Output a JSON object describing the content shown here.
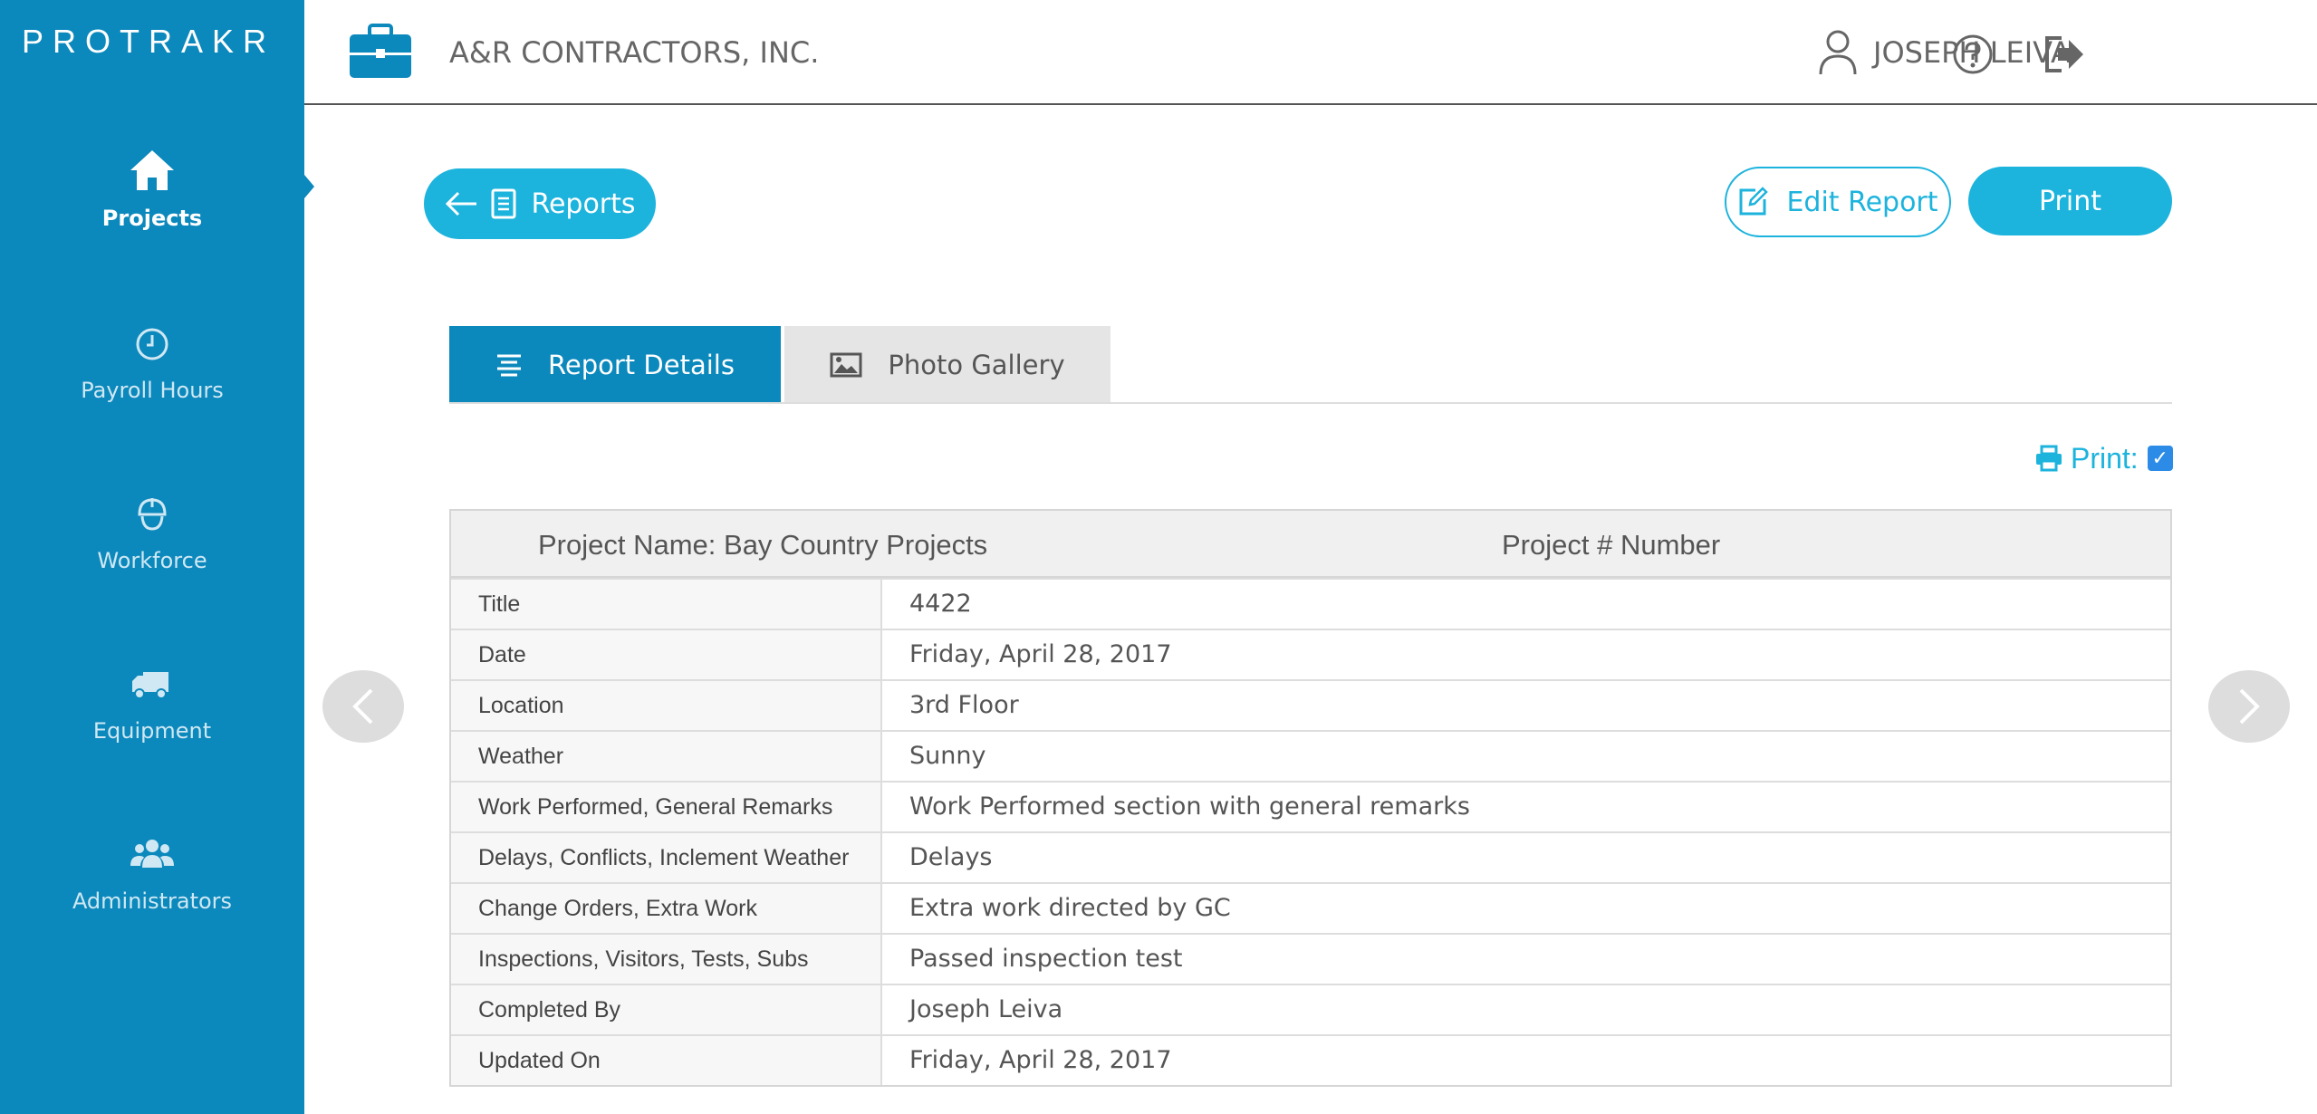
{
  "app": {
    "logo_text": "PROTRAKR",
    "company_name": "A&R CONTRACTORS, INC.",
    "user_name": "JOSEPH LEIVA"
  },
  "sidebar": {
    "items": [
      {
        "label": "Projects",
        "icon": "home-icon",
        "active": true
      },
      {
        "label": "Payroll Hours",
        "icon": "clock-icon",
        "active": false
      },
      {
        "label": "Workforce",
        "icon": "worker-icon",
        "active": false
      },
      {
        "label": "Equipment",
        "icon": "truck-icon",
        "active": false
      },
      {
        "label": "Administrators",
        "icon": "users-icon",
        "active": false
      }
    ]
  },
  "toolbar": {
    "back_label": "Reports",
    "edit_label": "Edit Report",
    "print_label": "Print"
  },
  "tabs": [
    {
      "label": "Report Details",
      "icon": "list-icon",
      "active": true
    },
    {
      "label": "Photo Gallery",
      "icon": "image-icon",
      "active": false
    }
  ],
  "print_toggle": {
    "label": "Print:",
    "checked": true
  },
  "report": {
    "project_name": "Project Name: Bay Country Projects",
    "project_number": "Project # Number",
    "rows": [
      {
        "label": "Title",
        "value": "4422"
      },
      {
        "label": "Date",
        "value": "Friday, April 28, 2017"
      },
      {
        "label": "Location",
        "value": "3rd Floor"
      },
      {
        "label": "Weather",
        "value": "Sunny"
      },
      {
        "label": "Work Performed, General Remarks",
        "value": "Work Performed section with general remarks"
      },
      {
        "label": "Delays, Conflicts, Inclement Weather",
        "value": "Delays"
      },
      {
        "label": "Change Orders, Extra Work",
        "value": "Extra work directed by GC"
      },
      {
        "label": "Inspections, Visitors, Tests, Subs",
        "value": "Passed inspection test"
      },
      {
        "label": "Completed By",
        "value": "Joseph Leiva"
      },
      {
        "label": "Updated On",
        "value": "Friday, April 28, 2017"
      }
    ]
  },
  "colors": {
    "sidebar": "#0b88bc",
    "accent": "#1cb3dd",
    "tab_inactive": "#e5e5e5",
    "checkbox": "#2b8be6"
  }
}
